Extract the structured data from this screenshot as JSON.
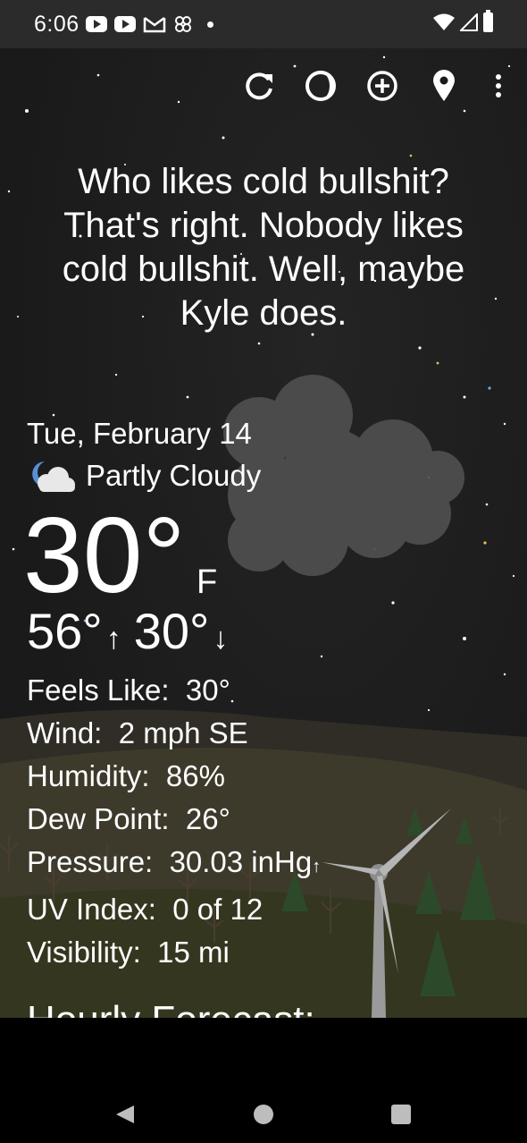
{
  "status_bar": {
    "time": "6:06",
    "left_icons": [
      "youtube-icon",
      "youtube-icon",
      "gmail-icon",
      "pinwheel-icon",
      "dot-icon"
    ],
    "right_icons": [
      "wifi-icon",
      "signal-icon",
      "battery-icon"
    ]
  },
  "toolbar": {
    "actions": [
      "refresh-icon",
      "moon-icon",
      "add-location-icon",
      "location-pin-icon",
      "more-vert-icon"
    ]
  },
  "quote": "Who likes cold bullshit? That's right. Nobody likes cold bullshit. Well, maybe Kyle does.",
  "weather": {
    "date": "Tue, February 14",
    "condition": "Partly Cloudy",
    "temperature": "30°",
    "unit": "F",
    "high": "56°",
    "low": "30°",
    "details": [
      {
        "label": "Feels Like:",
        "value": "30°"
      },
      {
        "label": "Wind:",
        "value": "2 mph SE"
      },
      {
        "label": "Humidity:",
        "value": "86%"
      },
      {
        "label": "Dew Point:",
        "value": "26°"
      },
      {
        "label": "Pressure:",
        "value": "30.03 inHg"
      },
      {
        "label": "UV Index:",
        "value": "0 of 12"
      },
      {
        "label": "Visibility:",
        "value": "15 mi"
      }
    ],
    "hourly_title": "Hourly Forecast:"
  },
  "nav": {
    "buttons": [
      "back-icon",
      "home-icon",
      "recents-icon"
    ]
  },
  "colors": {
    "background": "#1a1a1a",
    "status_bar": "#2b2b2b",
    "text": "#ffffff",
    "cloud": "#555555",
    "hills": "#3a3526"
  }
}
